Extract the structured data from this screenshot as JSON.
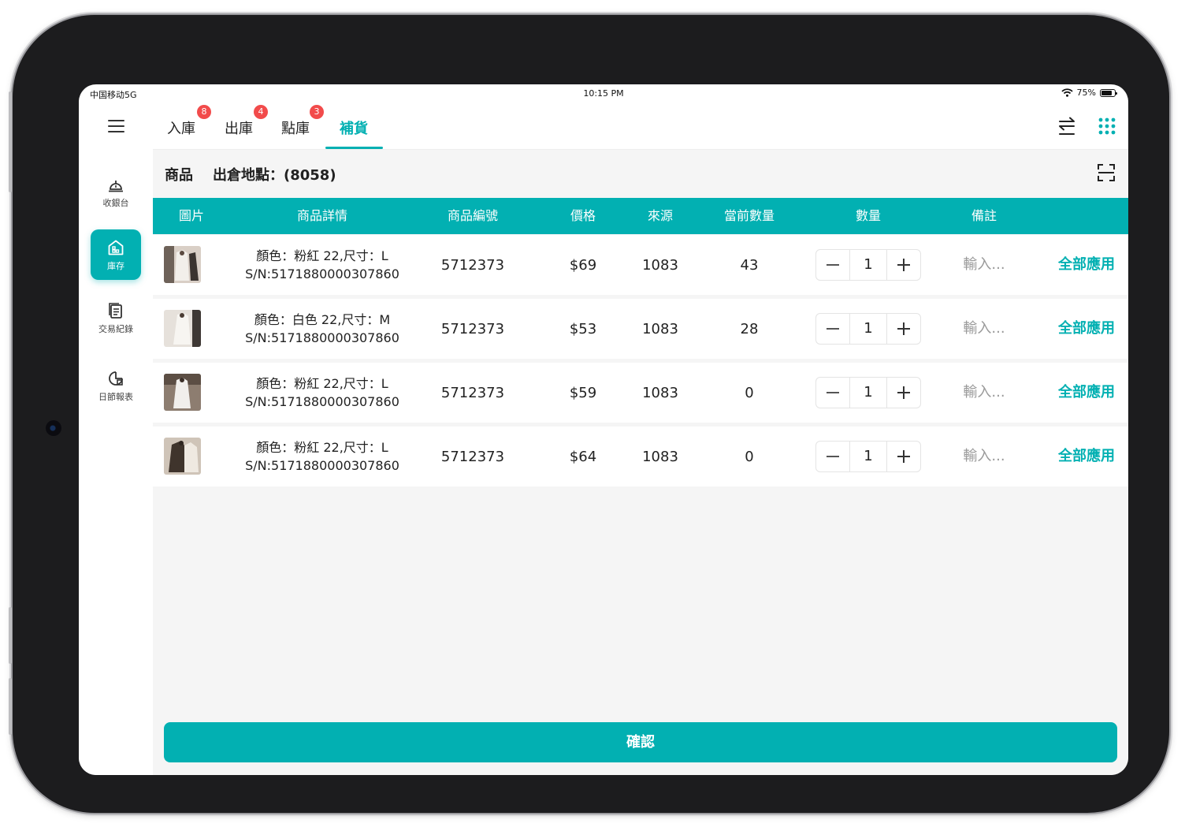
{
  "status_bar": {
    "carrier": "中国移动5G",
    "time": "10:15 PM",
    "battery": "75%"
  },
  "sidebar": {
    "items": [
      {
        "label": "收銀台",
        "icon": "cashier-bell-icon"
      },
      {
        "label": "庫存",
        "icon": "warehouse-icon",
        "active": true
      },
      {
        "label": "交易紀錄",
        "icon": "records-icon"
      },
      {
        "label": "日節報表",
        "icon": "report-chart-icon"
      }
    ]
  },
  "tabs": [
    {
      "label": "入庫",
      "badge": "8"
    },
    {
      "label": "出庫",
      "badge": "4"
    },
    {
      "label": "點庫",
      "badge": "3"
    },
    {
      "label": "補貨",
      "active": true
    }
  ],
  "subheader": {
    "title": "商品",
    "location": "出倉地點：(8058)"
  },
  "table": {
    "headers": [
      "圖片",
      "商品詳情",
      "商品編號",
      "價格",
      "來源",
      "當前數量",
      "數量",
      "備註"
    ],
    "note_placeholder": "輸入...",
    "apply_label": "全部應用",
    "rows": [
      {
        "detail_line1": "顏色：粉紅 22,尺寸：L",
        "detail_line2": "S/N:5171880000307860",
        "code": "5712373",
        "price": "$69",
        "source": "1083",
        "current": "43",
        "qty": "1"
      },
      {
        "detail_line1": "顏色：白色 22,尺寸：M",
        "detail_line2": "S/N:5171880000307860",
        "code": "5712373",
        "price": "$53",
        "source": "1083",
        "current": "28",
        "qty": "1"
      },
      {
        "detail_line1": "顏色：粉紅 22,尺寸：L",
        "detail_line2": "S/N:5171880000307860",
        "code": "5712373",
        "price": "$59",
        "source": "1083",
        "current": "0",
        "qty": "1"
      },
      {
        "detail_line1": "顏色：粉紅 22,尺寸：L",
        "detail_line2": "S/N:5171880000307860",
        "code": "5712373",
        "price": "$64",
        "source": "1083",
        "current": "0",
        "qty": "1"
      }
    ]
  },
  "confirm_label": "確認",
  "colors": {
    "accent": "#02b0b2",
    "badge": "#f24b4b",
    "background": "#f5f5f5"
  }
}
